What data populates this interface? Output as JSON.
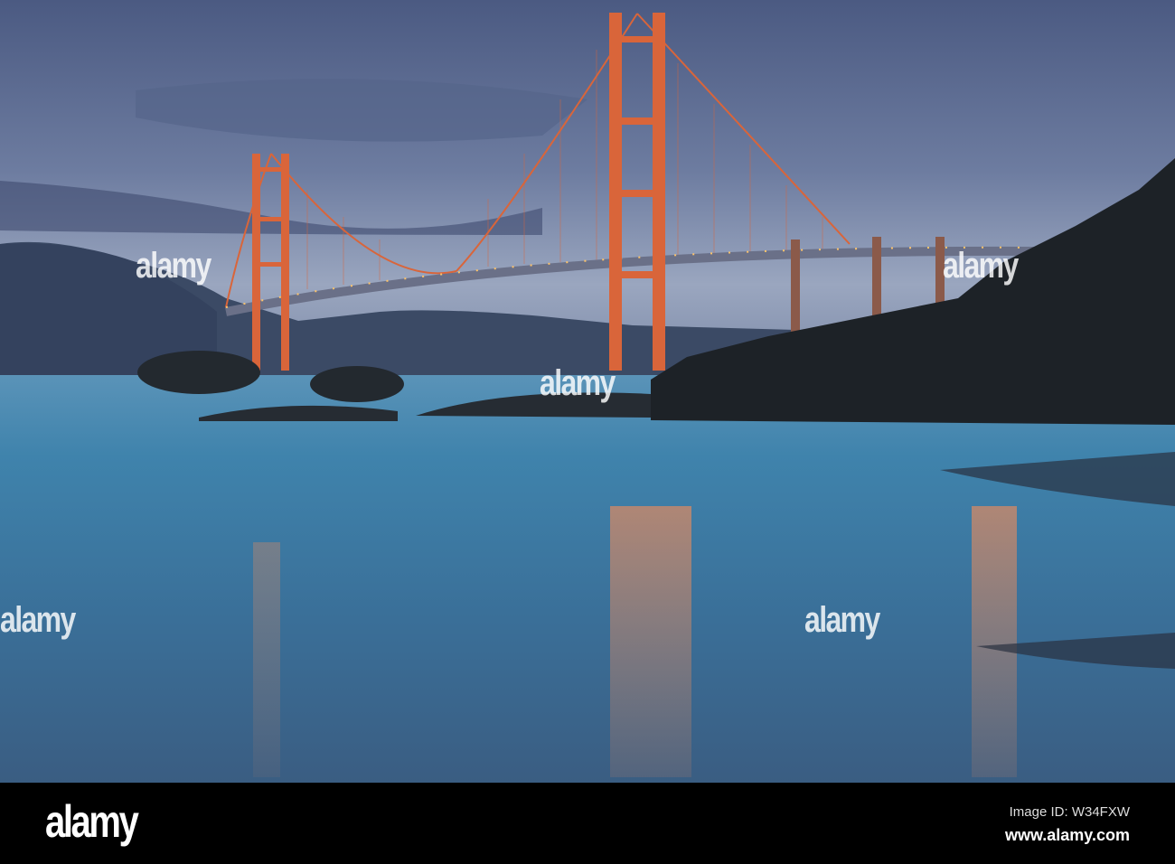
{
  "footer": {
    "logo": "alamy",
    "image_id": "Image ID: W34FXW",
    "url": "www.alamy.com"
  },
  "watermark": "alamy",
  "colors": {
    "sky_top": "#4b5a82",
    "sky_horizon": "#9aa6bf",
    "water": "#3f83ac",
    "bridge": "#d9653a",
    "lights": "#ffc46a",
    "rocks": "#1d2227"
  }
}
